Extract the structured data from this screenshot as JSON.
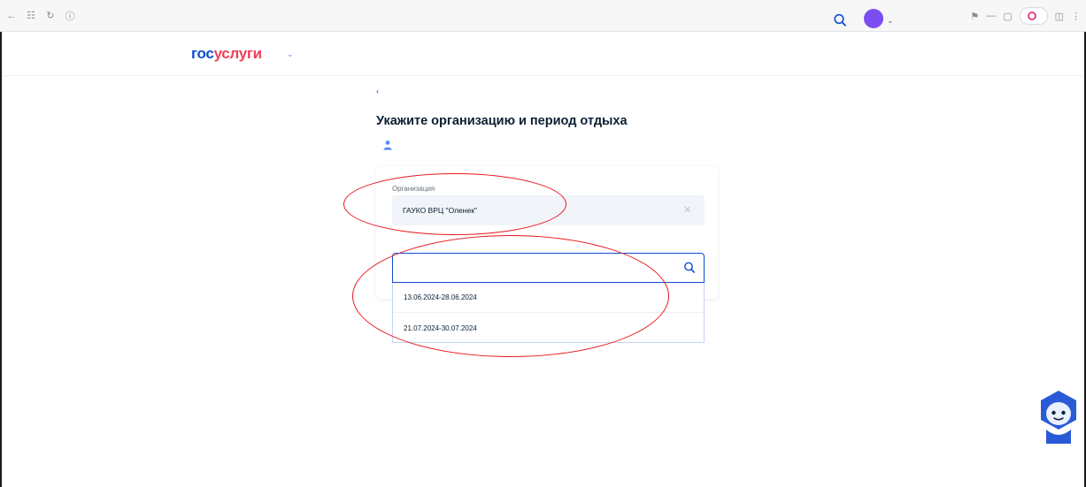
{
  "browser": {
    "url": "",
    "tab_title": "",
    "alice_label": ""
  },
  "header": {
    "logo_part1": "гос",
    "logo_part2": "услуги",
    "role_label": "",
    "menu": [
      "",
      "",
      "",
      "",
      ""
    ],
    "avatar_initials": ""
  },
  "page": {
    "back_label": "",
    "title": "Укажите организацию и период отдыха",
    "child_label": ""
  },
  "form": {
    "org_label": "Организация",
    "org_value": "ГАУКО ВРЦ \"Оленек\"",
    "period_label": "",
    "period_search_value": "",
    "period_options": [
      "13.06.2024-28.06.2024",
      "21.07.2024-30.07.2024"
    ]
  },
  "colors": {
    "brand_blue": "#0d4cd3",
    "brand_red": "#ee3f58",
    "annotation_red": "#e8171c",
    "avatar_purple": "#7c4ef2"
  },
  "icons": {
    "back": "arrow-left-icon",
    "forward": "arrow-right-icon",
    "reload": "reload-icon",
    "search": "search-icon",
    "clear": "close-icon",
    "child": "child-icon",
    "bot": "assistant-bot-icon"
  }
}
